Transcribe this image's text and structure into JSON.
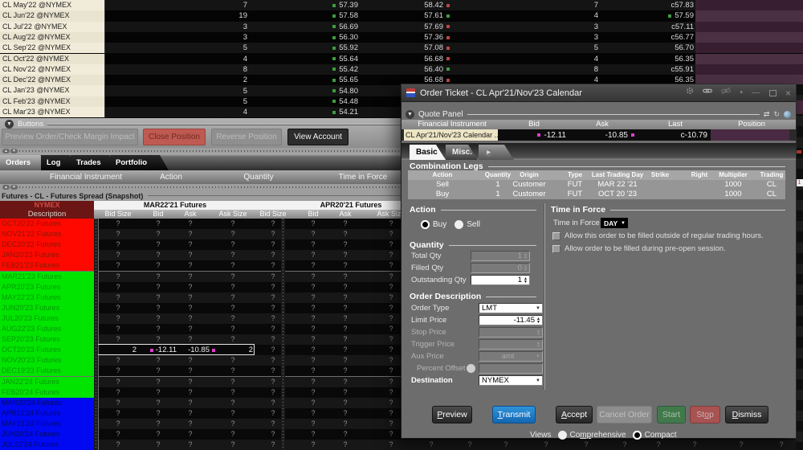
{
  "watchlist": {
    "rows": [
      {
        "name": "CL May'22 @NYMEX",
        "bid_size": "7",
        "bid": "57.39",
        "bid_tick": "up",
        "ask": "58.42",
        "ask_tick": "down",
        "ask_size": "7",
        "last": "c57.83",
        "last_tick": ""
      },
      {
        "name": "CL Jun'22 @NYMEX",
        "bid_size": "19",
        "bid": "57.58",
        "bid_tick": "up",
        "ask": "57.61",
        "ask_tick": "up",
        "ask_size": "4",
        "last": "57.59",
        "last_tick": "up"
      },
      {
        "name": "CL Jul'22 @NYMEX",
        "bid_size": "3",
        "bid": "56.69",
        "bid_tick": "up",
        "ask": "57.69",
        "ask_tick": "down",
        "ask_size": "3",
        "last": "c57.11",
        "last_tick": ""
      },
      {
        "name": "CL Aug'22 @NYMEX",
        "bid_size": "3",
        "bid": "56.30",
        "bid_tick": "up",
        "ask": "57.36",
        "ask_tick": "down",
        "ask_size": "3",
        "last": "c56.77",
        "last_tick": ""
      },
      {
        "name": "CL Sep'22 @NYMEX",
        "bid_size": "5",
        "bid": "55.92",
        "bid_tick": "up",
        "ask": "57.08",
        "ask_tick": "down",
        "ask_size": "5",
        "last": "56.70",
        "last_tick": ""
      },
      {
        "name": "CL Oct'22 @NYMEX",
        "bid_size": "4",
        "bid": "55.64",
        "bid_tick": "up",
        "ask": "56.68",
        "ask_tick": "down",
        "ask_size": "4",
        "last": "56.35",
        "last_tick": ""
      },
      {
        "name": "CL Nov'22 @NYMEX",
        "bid_size": "8",
        "bid": "55.42",
        "bid_tick": "up",
        "ask": "56.40",
        "ask_tick": "up",
        "ask_size": "8",
        "last": "c55.91",
        "last_tick": ""
      },
      {
        "name": "CL Dec'22 @NYMEX",
        "bid_size": "2",
        "bid": "55.65",
        "bid_tick": "up",
        "ask": "56.68",
        "ask_tick": "down",
        "ask_size": "4",
        "last": "56.35",
        "last_tick": ""
      },
      {
        "name": "CL Jan'23 @NYMEX",
        "bid_size": "5",
        "bid": "54.80",
        "bid_tick": "up",
        "ask": "",
        "ask_tick": "",
        "ask_size": "",
        "last": "",
        "last_tick": ""
      },
      {
        "name": "CL Feb'23 @NYMEX",
        "bid_size": "5",
        "bid": "54.48",
        "bid_tick": "up",
        "ask": "",
        "ask_tick": "",
        "ask_size": "",
        "last": "",
        "last_tick": ""
      },
      {
        "name": "CL Mar'23 @NYMEX",
        "bid_size": "4",
        "bid": "54.21",
        "bid_tick": "up",
        "ask": "",
        "ask_tick": "",
        "ask_size": "",
        "last": "",
        "last_tick": ""
      }
    ]
  },
  "buttons_panel": {
    "title": "Buttons",
    "buttons": [
      {
        "label": "Preview Order/Check Margin Impact",
        "style": "disabled"
      },
      {
        "label": "Close Position",
        "style": "danger"
      },
      {
        "label": "Reverse Position",
        "style": "disabled"
      },
      {
        "label": "View Account",
        "style": "dark"
      }
    ]
  },
  "orders_panel": {
    "tabs": [
      {
        "label": "Orders",
        "active": true
      },
      {
        "label": "Log",
        "active": false
      },
      {
        "label": "Trades",
        "active": false
      },
      {
        "label": "Portfolio",
        "active": false
      }
    ],
    "columns": [
      "Financial Instrument",
      "Action",
      "Quantity",
      "Time in Force"
    ]
  },
  "futures_panel": {
    "title": "Futures - CL - Futures Spread (Snapshot)",
    "exchange": "NYMEX",
    "description_header": "Description",
    "group_headers": [
      "MAR22'21 Futures",
      "APR20'21 Futures"
    ],
    "sub_columns": [
      "Bid Size",
      "Bid",
      "Ask",
      "Ask Size"
    ],
    "placeholder": "?",
    "rows": [
      {
        "label": "OCT20'22 Futures",
        "color": "red"
      },
      {
        "label": "NOV21'22 Futures",
        "color": "red"
      },
      {
        "label": "DEC20'22 Futures",
        "color": "red"
      },
      {
        "label": "JAN20'23 Futures",
        "color": "red"
      },
      {
        "label": "FEB21'23 Futures",
        "color": "red"
      },
      {
        "label": "MAR21'23 Futures",
        "color": "green"
      },
      {
        "label": "APR20'23 Futures",
        "color": "green"
      },
      {
        "label": "MAY22'23 Futures",
        "color": "green"
      },
      {
        "label": "JUN20'23 Futures",
        "color": "green"
      },
      {
        "label": "JUL20'23 Futures",
        "color": "green"
      },
      {
        "label": "AUG22'23 Futures",
        "color": "green"
      },
      {
        "label": "SEP20'23 Futures",
        "color": "green"
      },
      {
        "label": "OCT20'23 Futures",
        "color": "green",
        "selected": true,
        "bid_size": "2",
        "bid": "-12.11",
        "ask": "-10.85",
        "ask_size": "2"
      },
      {
        "label": "NOV20'23 Futures",
        "color": "green"
      },
      {
        "label": "DEC19'23 Futures",
        "color": "green"
      },
      {
        "label": "JAN22'24 Futures",
        "color": "green"
      },
      {
        "label": "FEB20'24 Futures",
        "color": "green"
      },
      {
        "label": "MAR20'24 Futures",
        "color": "blue"
      },
      {
        "label": "APR22'24 Futures",
        "color": "blue"
      },
      {
        "label": "MAY21'24 Futures",
        "color": "blue"
      },
      {
        "label": "JUN20'24 Futures",
        "color": "blue"
      },
      {
        "label": "JUL22'24 Futures",
        "color": "blue"
      }
    ]
  },
  "order_ticket": {
    "title": "Order Ticket - CL Apr'21/Nov'23 Calendar",
    "quote_panel": {
      "title": "Quote Panel",
      "columns": [
        "Financial Instrument",
        "Bid",
        "Ask",
        "Last",
        "Position"
      ],
      "row": {
        "instrument": "CL Apr'21/Nov'23 Calendar ...",
        "bid": "-12.11",
        "ask": "-10.85",
        "last": "c-10.79",
        "position": ""
      }
    },
    "tabs": {
      "basic": "Basic",
      "misc": "Misc."
    },
    "combination_legs": {
      "title": "Combination Legs",
      "columns": [
        "Action",
        "Quantity",
        "Origin",
        "Type",
        "Last Trading Day",
        "Strike",
        "Right",
        "Multiplier",
        "Trading Class"
      ],
      "rows": [
        {
          "action": "Sell",
          "quantity": "1",
          "origin": "Customer",
          "type": "FUT",
          "last_trading_day": "MAR 22 '21",
          "strike": "",
          "right": "",
          "multiplier": "1000",
          "trading_class": "CL"
        },
        {
          "action": "Buy",
          "quantity": "1",
          "origin": "Customer",
          "type": "FUT",
          "last_trading_day": "OCT 20 '23",
          "strike": "",
          "right": "",
          "multiplier": "1000",
          "trading_class": "CL"
        }
      ]
    },
    "action_section": {
      "title": "Action",
      "options": [
        {
          "label": "Buy",
          "selected": true
        },
        {
          "label": "Sell",
          "selected": false
        }
      ]
    },
    "tif_section": {
      "title": "Time in Force",
      "label": "Time in Force",
      "value": "DAY",
      "checkboxes": [
        {
          "label": "Allow this order to be filled outside of regular trading hours.",
          "checked": false
        },
        {
          "label": "Allow order to be filled during pre-open session.",
          "checked": false
        }
      ]
    },
    "quantity_section": {
      "title": "Quantity",
      "fields": [
        {
          "label": "Total Qty",
          "value": "1",
          "enabled": false
        },
        {
          "label": "Filled Qty",
          "value": "0",
          "enabled": false
        },
        {
          "label": "Outstanding Qty",
          "value": "1",
          "enabled": true
        }
      ]
    },
    "order_description": {
      "title": "Order Description",
      "order_type_label": "Order Type",
      "order_type_value": "LMT",
      "limit_price_label": "Limit Price",
      "limit_price_value": "-11.45",
      "stop_price_label": "Stop Price",
      "stop_price_value": "",
      "trigger_price_label": "Trigger Price",
      "trigger_price_value": "",
      "aux_price_label": "Aux Price",
      "aux_price_value": "amt",
      "percent_offset_label": "Percent Offset",
      "percent_offset_value": "",
      "destination_label": "Destination",
      "destination_value": "NYMEX"
    },
    "footer": {
      "buttons": [
        {
          "label": "Preview",
          "accel": "P",
          "style": "dark"
        },
        {
          "label": "Transmit",
          "accel": "T",
          "style": "primary"
        },
        {
          "label": "Accept",
          "accel": "A",
          "style": "dark"
        },
        {
          "label": "Cancel Order",
          "accel": "",
          "style": "disabled"
        },
        {
          "label": "Start",
          "accel": "",
          "style": "green"
        },
        {
          "label": "Stop",
          "accel": "o",
          "style": "red"
        },
        {
          "label": "Dismiss",
          "accel": "D",
          "style": "dark"
        }
      ],
      "views_label": "Views",
      "views": [
        {
          "label": "Comprehensive",
          "accel": "mp",
          "selected": false
        },
        {
          "label": "Compact",
          "accel": "",
          "selected": true
        }
      ]
    }
  },
  "right_edge": {
    "value": "1"
  }
}
